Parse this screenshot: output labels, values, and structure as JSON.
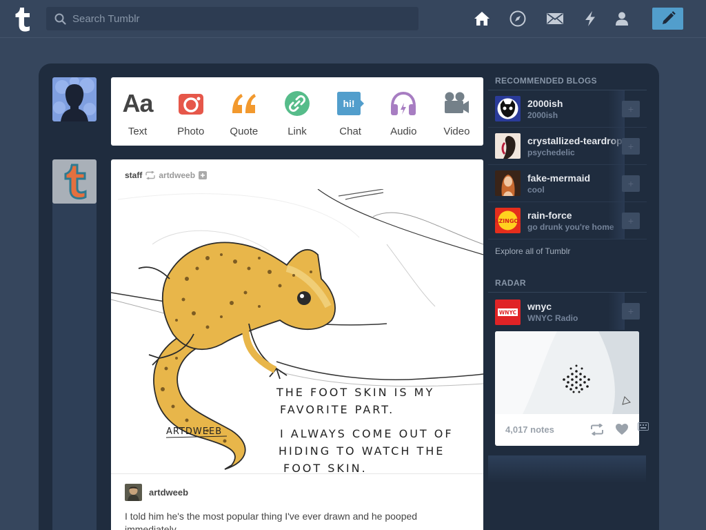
{
  "header": {
    "search_placeholder": "Search Tumblr",
    "nav": [
      "home-icon",
      "explore-compass-icon",
      "inbox-icon",
      "activity-bolt-icon",
      "account-icon"
    ],
    "compose_icon": "pencil-icon",
    "accent": "#529ecc"
  },
  "post_types": [
    {
      "label": "Text",
      "icon": "text-aa-icon",
      "color": "#444444"
    },
    {
      "label": "Photo",
      "icon": "camera-icon",
      "color": "#e6574a"
    },
    {
      "label": "Quote",
      "icon": "quote-icon",
      "color": "#f2992e"
    },
    {
      "label": "Link",
      "icon": "link-icon",
      "color": "#56bc8a"
    },
    {
      "label": "Chat",
      "icon": "chat-icon",
      "color": "#529ecc"
    },
    {
      "label": "Audio",
      "icon": "headphones-icon",
      "color": "#a77dc2"
    },
    {
      "label": "Video",
      "icon": "video-camera-icon",
      "color": "#748089"
    }
  ],
  "post": {
    "author": "staff",
    "reblogged_from": "artdweeb",
    "image_text": {
      "line1": "THE FOOT SKIN IS MY",
      "line2": "FAVORITE PART.",
      "line3": "I ALWAYS COME OUT OF",
      "line4": "HIDING TO WATCH THE",
      "line5": "FOOT SKIN.",
      "signature": "ARTDWEEB"
    },
    "reblog_author": "artdweeb",
    "body": "I told him he's the most popular thing I've ever drawn and he pooped immediately."
  },
  "sidebar": {
    "recommended_title": "RECOMMENDED BLOGS",
    "blogs": [
      {
        "name": "2000ish",
        "subtitle": "2000ish"
      },
      {
        "name": "crystallized-teardrops",
        "subtitle": "psychedelic"
      },
      {
        "name": "fake-mermaid",
        "subtitle": "cool"
      },
      {
        "name": "rain-force",
        "subtitle": "go drunk you're home"
      }
    ],
    "rain_force_avatar_text": "AZINGO!",
    "explore_label": "Explore all of Tumblr",
    "radar_title": "RADAR",
    "radar": {
      "name": "wnyc",
      "subtitle": "WNYC Radio",
      "logo_text": "WNYC",
      "notes": "4,017 notes"
    }
  }
}
